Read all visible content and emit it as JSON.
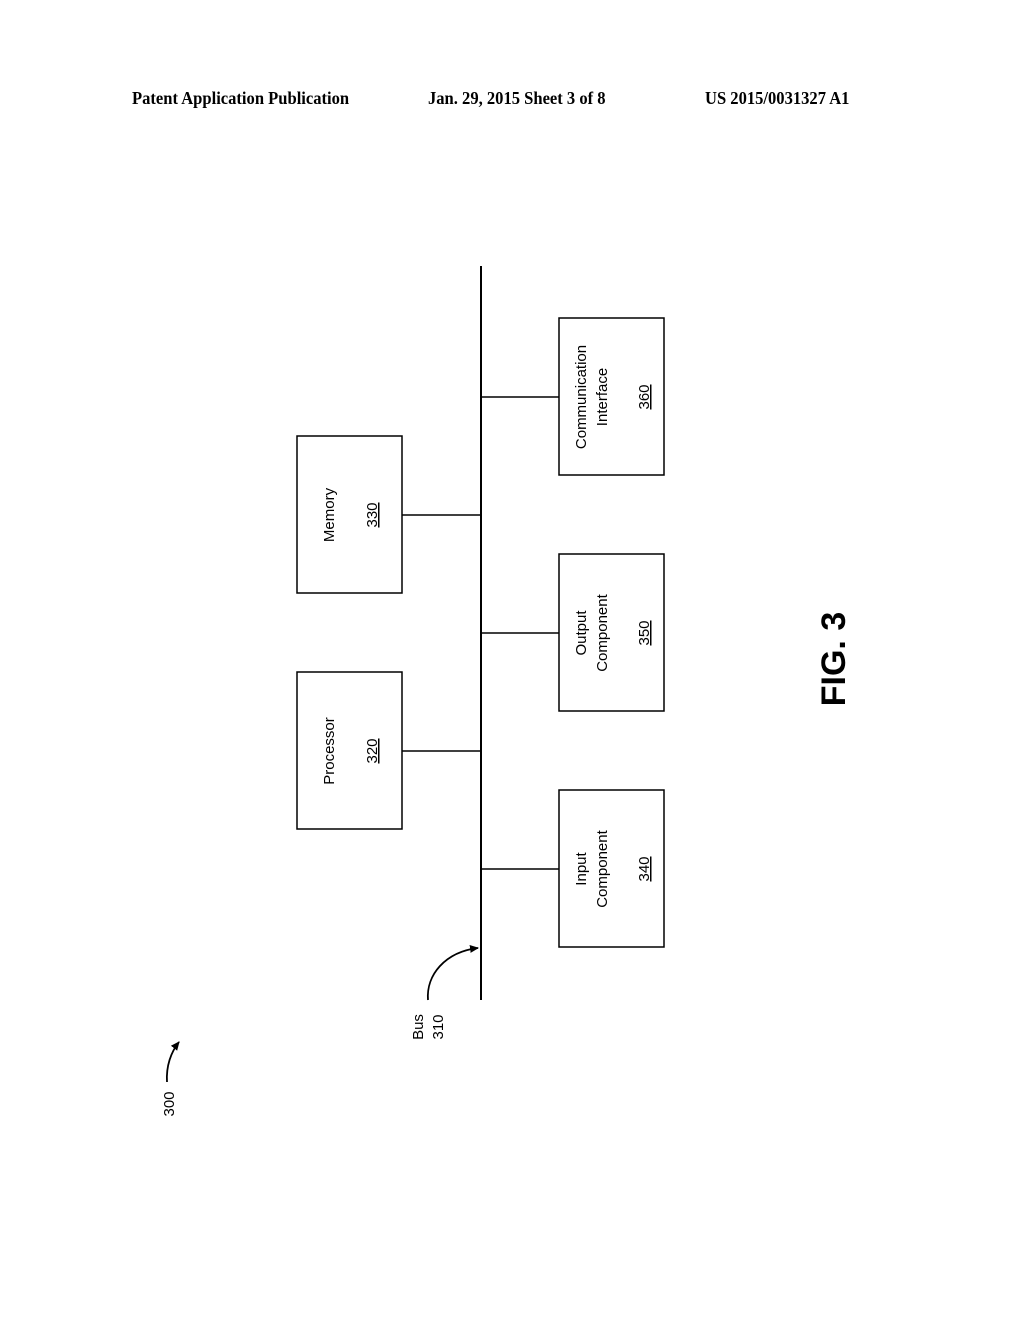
{
  "header": {
    "publication": "Patent Application Publication",
    "date_sheet": "Jan. 29, 2015  Sheet 3 of 8",
    "patent_number": "US 2015/0031327 A1"
  },
  "figure": {
    "label": "FIG. 3",
    "reference": "300",
    "bus": {
      "name": "Bus",
      "ref": "310"
    },
    "components": {
      "processor": {
        "name": "Processor",
        "ref": "320"
      },
      "memory": {
        "name": "Memory",
        "ref": "330"
      },
      "input": {
        "line1": "Input",
        "line2": "Component",
        "ref": "340"
      },
      "output": {
        "line1": "Output",
        "line2": "Component",
        "ref": "350"
      },
      "comm": {
        "line1": "Communication",
        "line2": "Interface",
        "ref": "360"
      }
    }
  }
}
